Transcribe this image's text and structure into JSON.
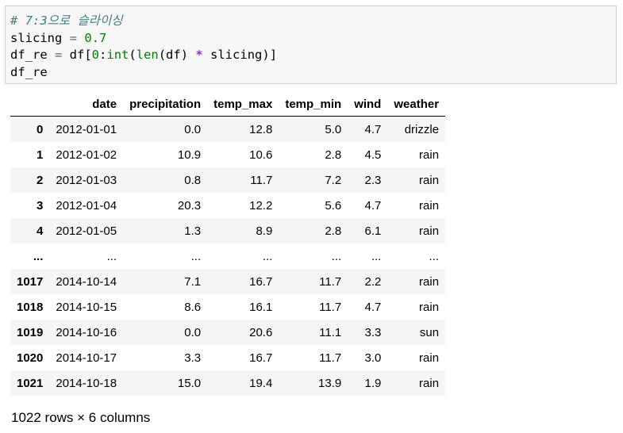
{
  "code_cell": {
    "lines": [
      [
        {
          "t": "# 7:3으로 슬라이싱",
          "c": "c-comment"
        }
      ],
      [
        {
          "t": "slicing ",
          "c": ""
        },
        {
          "t": "=",
          "c": "c-op"
        },
        {
          "t": " ",
          "c": ""
        },
        {
          "t": "0.7",
          "c": "c-num"
        }
      ],
      [
        {
          "t": "df_re ",
          "c": ""
        },
        {
          "t": "=",
          "c": "c-op"
        },
        {
          "t": " df[",
          "c": ""
        },
        {
          "t": "0",
          "c": "c-num"
        },
        {
          "t": ":",
          "c": ""
        },
        {
          "t": "int",
          "c": "c-builtin"
        },
        {
          "t": "(",
          "c": ""
        },
        {
          "t": "len",
          "c": "c-builtin"
        },
        {
          "t": "(df) ",
          "c": ""
        },
        {
          "t": "*",
          "c": "c-op2"
        },
        {
          "t": " slicing)]",
          "c": ""
        }
      ],
      [
        {
          "t": "df_re",
          "c": ""
        }
      ]
    ]
  },
  "dataframe": {
    "columns": [
      "",
      "date",
      "precipitation",
      "temp_max",
      "temp_min",
      "wind",
      "weather"
    ],
    "rows": [
      [
        "0",
        "2012-01-01",
        "0.0",
        "12.8",
        "5.0",
        "4.7",
        "drizzle"
      ],
      [
        "1",
        "2012-01-02",
        "10.9",
        "10.6",
        "2.8",
        "4.5",
        "rain"
      ],
      [
        "2",
        "2012-01-03",
        "0.8",
        "11.7",
        "7.2",
        "2.3",
        "rain"
      ],
      [
        "3",
        "2012-01-04",
        "20.3",
        "12.2",
        "5.6",
        "4.7",
        "rain"
      ],
      [
        "4",
        "2012-01-05",
        "1.3",
        "8.9",
        "2.8",
        "6.1",
        "rain"
      ],
      [
        "...",
        "...",
        "...",
        "...",
        "...",
        "...",
        "..."
      ],
      [
        "1017",
        "2014-10-14",
        "7.1",
        "16.7",
        "11.7",
        "2.2",
        "rain"
      ],
      [
        "1018",
        "2014-10-15",
        "8.6",
        "16.1",
        "11.7",
        "4.7",
        "rain"
      ],
      [
        "1019",
        "2014-10-16",
        "0.0",
        "20.6",
        "11.1",
        "3.3",
        "sun"
      ],
      [
        "1020",
        "2014-10-17",
        "3.3",
        "16.7",
        "11.7",
        "3.0",
        "rain"
      ],
      [
        "1021",
        "2014-10-18",
        "15.0",
        "19.4",
        "13.9",
        "1.9",
        "rain"
      ]
    ]
  },
  "summary": "1022 rows × 6 columns"
}
